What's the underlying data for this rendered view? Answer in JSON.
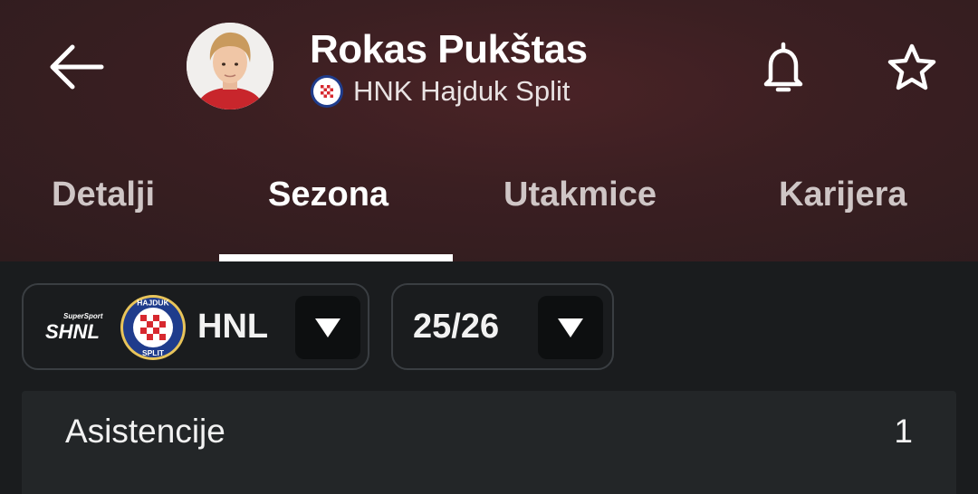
{
  "header": {
    "player_name": "Rokas Pukštas",
    "club_name": "HNK Hajduk Split",
    "icons": {
      "back": "arrow-left-icon",
      "notify": "bell-icon",
      "favorite": "star-icon"
    }
  },
  "tabs": [
    {
      "label": "Detalji",
      "active": false
    },
    {
      "label": "Sezona",
      "active": true
    },
    {
      "label": "Utakmice",
      "active": false
    },
    {
      "label": "Karijera",
      "active": false
    }
  ],
  "filters": {
    "league": {
      "label": "HNL",
      "logo_text": "SHNL",
      "logo_small": "SuperSport"
    },
    "season": {
      "label": "25/26"
    }
  },
  "club_crest": {
    "top_text": "HAJDUK",
    "bottom_text": "SPLIT"
  },
  "stats": [
    {
      "label": "Asistencije",
      "value": "1"
    }
  ],
  "colors": {
    "header_bg": "#3b1f22",
    "page_bg": "#1a1c1e",
    "panel_bg": "#232628",
    "crest_red": "#d7282f",
    "crest_blue": "#1f3c8c"
  }
}
